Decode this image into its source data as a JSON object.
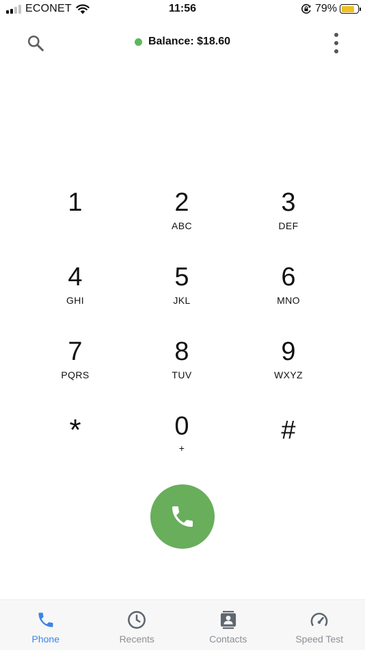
{
  "status_bar": {
    "carrier": "ECONET",
    "time": "11:56",
    "battery_percent": "79%",
    "battery_level": 0.79,
    "signal_bars": 2,
    "icons": [
      "signal-icon",
      "wifi-icon",
      "rotation-lock-icon",
      "battery-icon"
    ]
  },
  "header": {
    "balance": "Balance: $18.60",
    "status_color": "#5cb85c",
    "icons": [
      "search-icon",
      "more-vertical-icon"
    ]
  },
  "keypad": {
    "keys": [
      {
        "digit": "1",
        "letters": ""
      },
      {
        "digit": "2",
        "letters": "ABC"
      },
      {
        "digit": "3",
        "letters": "DEF"
      },
      {
        "digit": "4",
        "letters": "GHI"
      },
      {
        "digit": "5",
        "letters": "JKL"
      },
      {
        "digit": "6",
        "letters": "MNO"
      },
      {
        "digit": "7",
        "letters": "PQRS"
      },
      {
        "digit": "8",
        "letters": "TUV"
      },
      {
        "digit": "9",
        "letters": "WXYZ"
      },
      {
        "digit": "*",
        "letters": ""
      },
      {
        "digit": "0",
        "letters": "+"
      },
      {
        "digit": "#",
        "letters": ""
      }
    ]
  },
  "call_button": {
    "color": "#68ae5b",
    "icon": "phone-icon"
  },
  "tabs": [
    {
      "label": "Phone",
      "icon": "phone-icon",
      "active": true
    },
    {
      "label": "Recents",
      "icon": "clock-icon",
      "active": false
    },
    {
      "label": "Contacts",
      "icon": "contacts-icon",
      "active": false
    },
    {
      "label": "Speed Test",
      "icon": "speedometer-icon",
      "active": false
    }
  ],
  "colors": {
    "accent": "#3d84e6",
    "inactive": "#8a8f96",
    "battery": "#f2c01c"
  }
}
